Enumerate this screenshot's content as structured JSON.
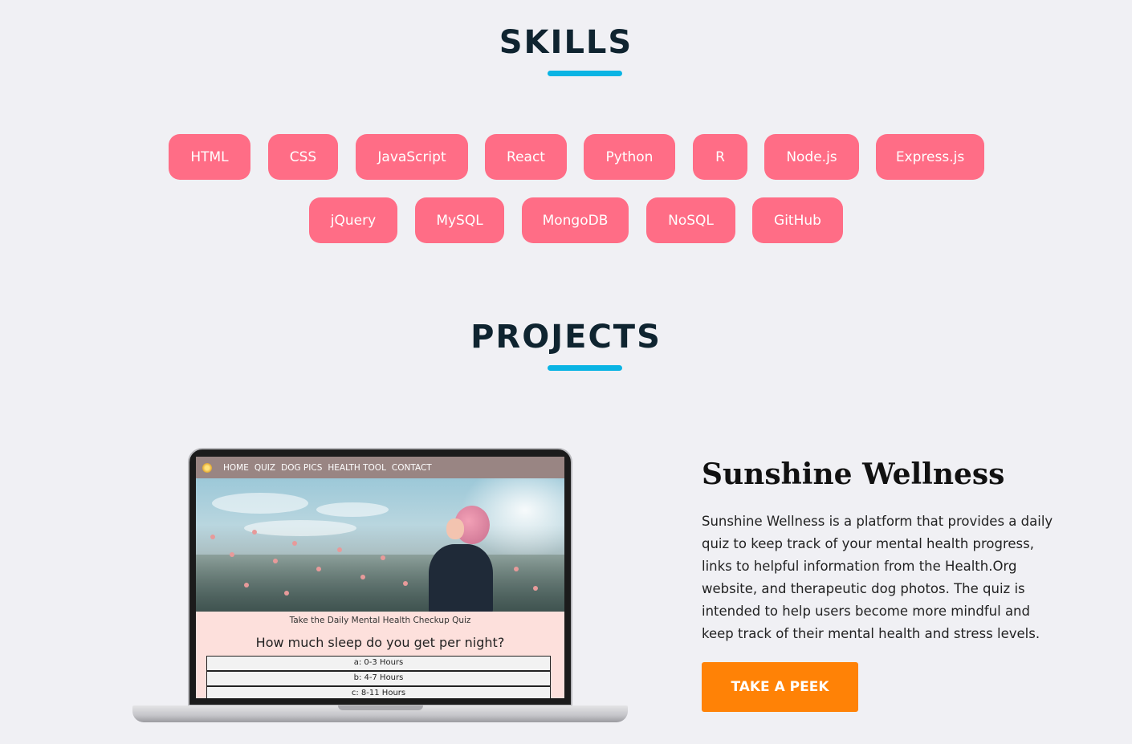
{
  "skills_section": {
    "title": "SKILLS",
    "items": [
      "HTML",
      "CSS",
      "JavaScript",
      "React",
      "Python",
      "R",
      "Node.js",
      "Express.js",
      "jQuery",
      "MySQL",
      "MongoDB",
      "NoSQL",
      "GitHub"
    ]
  },
  "projects_section": {
    "title": "PROJECTS",
    "project": {
      "title": "Sunshine Wellness",
      "description": "Sunshine Wellness is a platform that provides a daily quiz to keep track of your mental health progress, links to helpful information from the Health.Org website, and therapeutic dog photos. The quiz is intended to help users become more mindful and keep track of their mental health and stress levels.",
      "button_label": "TAKE A PEEK",
      "preview": {
        "nav": [
          "HOME",
          "QUIZ",
          "DOG PICS",
          "HEALTH TOOL",
          "CONTACT"
        ],
        "quiz_title": "Take the Daily Mental Health Checkup Quiz",
        "question": "How much sleep do you get per night?",
        "answers": [
          "a: 0-3 Hours",
          "b: 4-7 Hours",
          "c: 8-11 Hours"
        ]
      }
    }
  },
  "colors": {
    "background": "#f0f0f4",
    "accent_underline": "#0ab4e4",
    "skill_pill": "#ff6d86",
    "button": "#ff8206"
  }
}
